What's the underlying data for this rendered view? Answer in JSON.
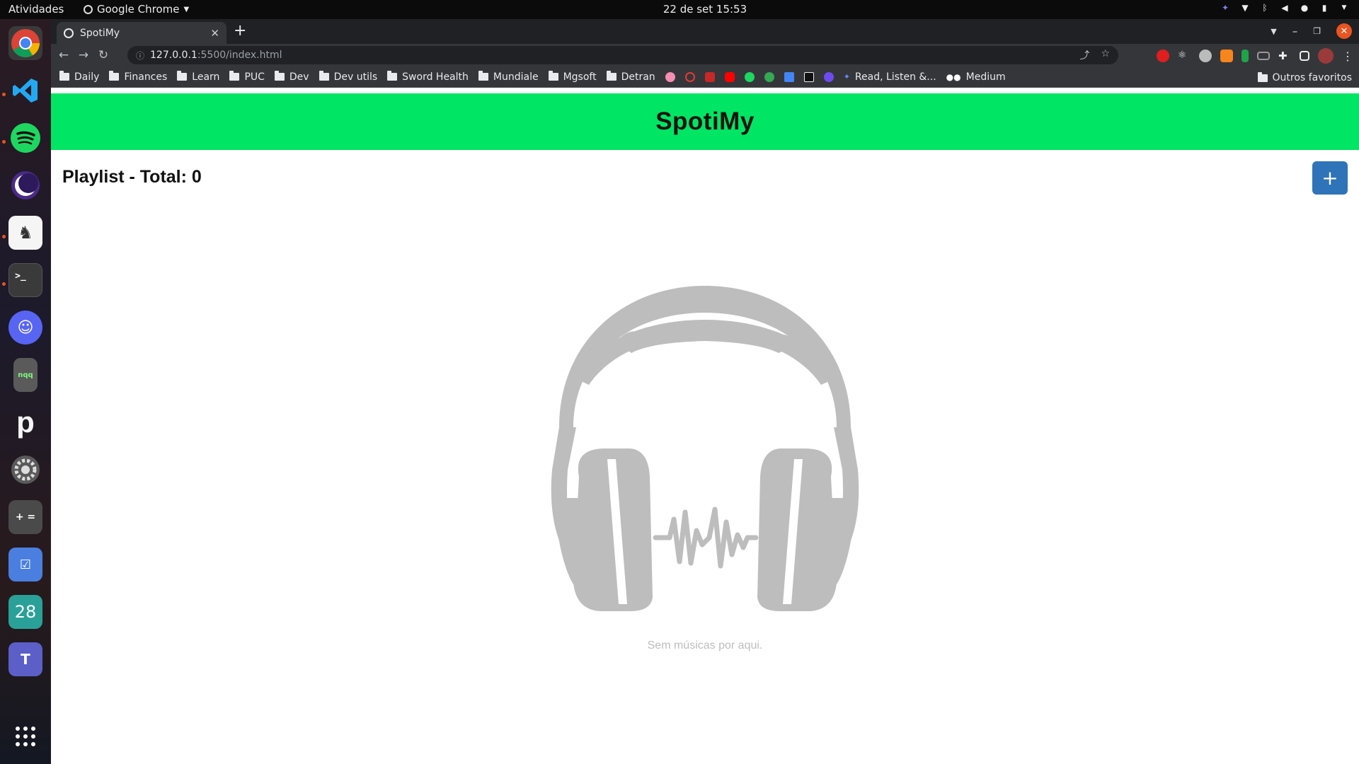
{
  "system_bar": {
    "activities": "Atividades",
    "app_name": "Google Chrome",
    "clock": "22 de set  15:53"
  },
  "dock": {
    "items": [
      "chrome",
      "vscode",
      "spotify",
      "eclipse",
      "insomnia",
      "terminal",
      "discord",
      "nqq",
      "pcloud",
      "settings",
      "calculator",
      "tasks",
      "calendar",
      "teams",
      "app-grid"
    ],
    "calendar_day": "28",
    "nqq_label": "nqq"
  },
  "browser": {
    "tab_title": "SpotiMy",
    "url_host": "127.0.0.1",
    "url_path": ":5500/index.html",
    "bookmarks": [
      "Daily",
      "Finances",
      "Learn",
      "PUC",
      "Dev",
      "Dev utils",
      "Sword Health",
      "Mundiale",
      "Mgsoft",
      "Detran"
    ],
    "bookmark_read": "Read, Listen &...",
    "bookmark_medium": "Medium",
    "other_bookmarks": "Outros favoritos"
  },
  "app": {
    "title": "SpotiMy",
    "playlist_label": "Playlist - Total: 0",
    "add_button": "+",
    "empty_message": "Sem músicas por aqui."
  },
  "colors": {
    "header_bg": "#00e563",
    "add_button_bg": "#2f73b8",
    "illustration": "#bdbdbd"
  }
}
